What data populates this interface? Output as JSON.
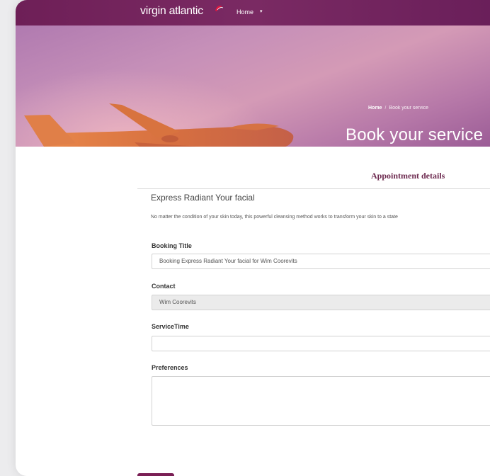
{
  "nav": {
    "brand": "virgin atlantic",
    "home_label": "Home",
    "home_caret": "▾"
  },
  "hero": {
    "breadcrumb_home": "Home",
    "breadcrumb_sep": "/",
    "breadcrumb_current": "Book your service",
    "title": "Book your service"
  },
  "form": {
    "section_title": "Appointment details",
    "service_name": "Express Radiant Your facial",
    "service_description": "No matter the condition of your skin today, this powerful cleansing method works to transform your skin to a state",
    "booking_title_label": "Booking Title",
    "booking_title_value": "Booking Express Radiant Your facial for Wim Coorevits",
    "contact_label": "Contact",
    "contact_value": "Wim Coorevits",
    "service_time_label": "ServiceTime",
    "service_time_value": "",
    "preferences_label": "Preferences",
    "preferences_value": ""
  },
  "colors": {
    "nav_bg": "#6e1f57",
    "section_title": "#6d2a4f",
    "accent": "#7a1f55"
  }
}
